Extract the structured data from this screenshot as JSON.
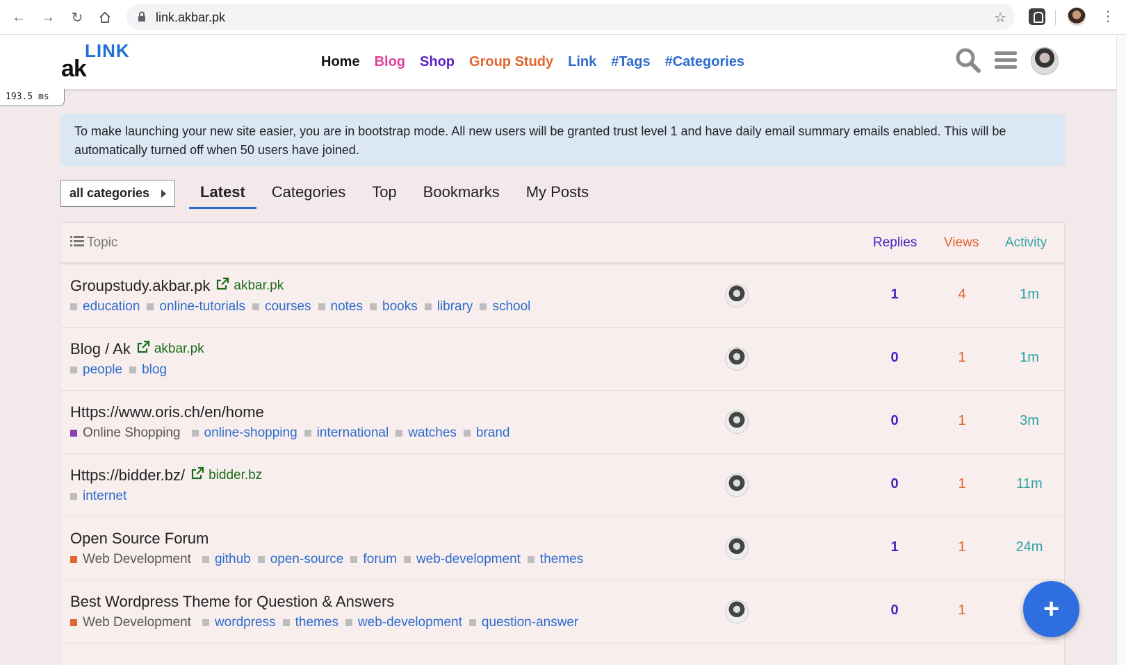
{
  "browser": {
    "url": "link.akbar.pk"
  },
  "site": {
    "logo_top": "LINK",
    "logo_bottom": "ak",
    "nav": [
      {
        "label": "Home",
        "color": "#111111"
      },
      {
        "label": "Blog",
        "color": "#e2409a"
      },
      {
        "label": "Shop",
        "color": "#5a1fc4"
      },
      {
        "label": "Group Study",
        "color": "#e0652e"
      },
      {
        "label": "Link",
        "color": "#2b6ccb"
      },
      {
        "label": "#Tags",
        "color": "#2b6ccb"
      },
      {
        "label": "#Categories",
        "color": "#2b6ccb"
      }
    ],
    "search_icon": "search-icon",
    "menu_icon": "hamburger-menu-icon"
  },
  "timer": "193.5 ms",
  "banner": {
    "text": "To make launching your new site easier, you are in bootstrap mode. All new users will be granted trust level 1 and have daily email summary emails enabled. This will be automatically turned off when 50 users have joined."
  },
  "filters": {
    "category_dropdown": "all categories",
    "tabs": [
      "Latest",
      "Categories",
      "Top",
      "Bookmarks",
      "My Posts"
    ],
    "active_tab": "Latest"
  },
  "table": {
    "header": {
      "topic": "Topic",
      "replies": "Replies",
      "views": "Views",
      "activity": "Activity"
    },
    "header_colors": {
      "replies": "#4a1fc4",
      "views": "#e0652e",
      "activity": "#2ba3a3"
    },
    "rows": [
      {
        "title": "Groupstudy.akbar.pk",
        "link": "akbar.pk",
        "category": "",
        "tags": [
          "education",
          "online-tutorials",
          "courses",
          "notes",
          "books",
          "library",
          "school"
        ],
        "replies": "1",
        "views": "4",
        "activity": "1m"
      },
      {
        "title": "Blog / Ak",
        "link": "akbar.pk",
        "category": "",
        "tags": [
          "people",
          "blog"
        ],
        "replies": "0",
        "views": "1",
        "activity": "1m"
      },
      {
        "title": "Https://www.oris.ch/en/home",
        "link": "",
        "category": "Online Shopping",
        "category_color": "#8e3fae",
        "tags": [
          "online-shopping",
          "international",
          "watches",
          "brand"
        ],
        "replies": "0",
        "views": "1",
        "activity": "3m"
      },
      {
        "title": "Https://bidder.bz/",
        "link": "bidder.bz",
        "category": "",
        "tags": [
          "internet"
        ],
        "replies": "0",
        "views": "1",
        "activity": "11m"
      },
      {
        "title": "Open Source Forum",
        "link": "",
        "category": "Web Development",
        "category_color": "#e0652e",
        "tags": [
          "github",
          "open-source",
          "forum",
          "web-development",
          "themes"
        ],
        "replies": "1",
        "views": "1",
        "activity": "24m"
      },
      {
        "title": "Best Wordpress Theme for Question & Answers",
        "link": "",
        "category": "Web Development",
        "category_color": "#e0652e",
        "tags": [
          "wordpress",
          "themes",
          "web-development",
          "question-answer"
        ],
        "replies": "0",
        "views": "1",
        "activity": ""
      }
    ]
  },
  "fab": "+"
}
